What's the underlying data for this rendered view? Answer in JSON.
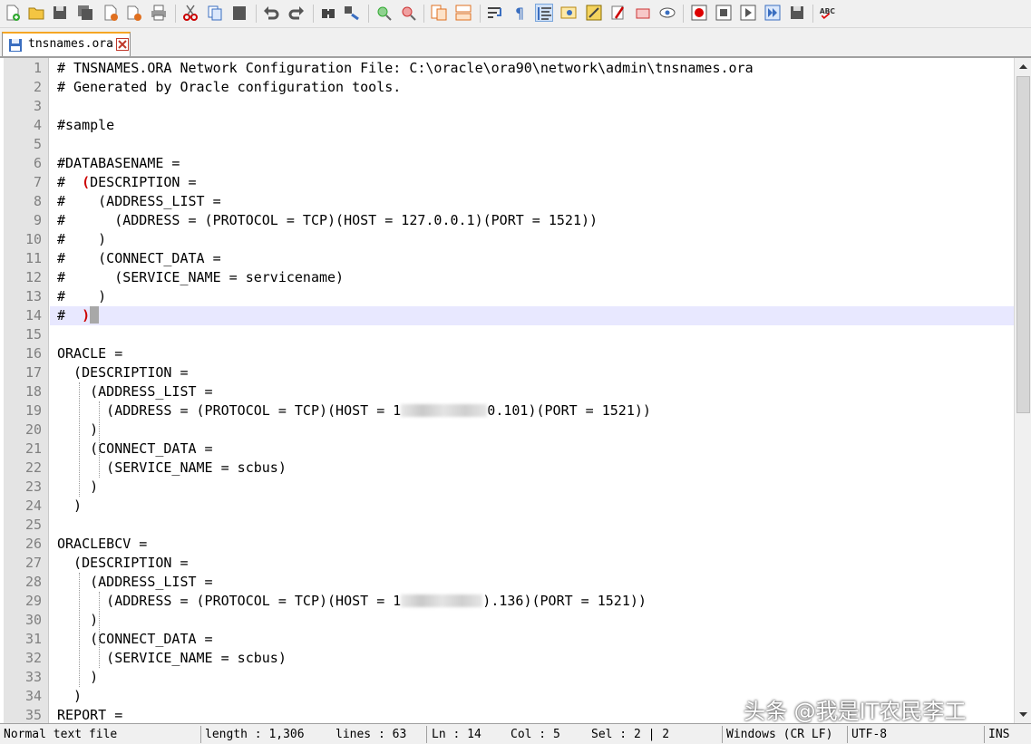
{
  "toolbar": {
    "icons": [
      "new-file-icon",
      "open-file-icon",
      "save-icon",
      "save-all-icon",
      "close-icon",
      "close-all-icon",
      "print-icon",
      "cut-icon",
      "copy-icon",
      "paste-icon",
      "undo-icon",
      "redo-icon",
      "find-icon",
      "replace-icon",
      "zoom-in-icon",
      "zoom-out-icon",
      "sync-vertical-icon",
      "sync-horizontal-icon",
      "word-wrap-icon",
      "show-all-chars-icon",
      "indent-guide-icon",
      "user-language-icon",
      "function-list-icon",
      "folder-workspace-icon",
      "document-map-icon",
      "monitor-icon",
      "record-macro-icon",
      "stop-macro-icon",
      "playback-macro-icon",
      "run-macro-multiple-icon",
      "save-macro-icon",
      "spell-check-icon"
    ],
    "spellcheck_label": "ABC"
  },
  "tab": {
    "label": "tnsnames.ora"
  },
  "editor": {
    "current_line": 14,
    "lines": [
      {
        "n": "1",
        "t": "# TNSNAMES.ORA Network Configuration File: C:\\oracle\\ora90\\network\\admin\\tnsnames.ora"
      },
      {
        "n": "2",
        "t": "# Generated by Oracle configuration tools."
      },
      {
        "n": "3",
        "t": ""
      },
      {
        "n": "4",
        "t": "#sample"
      },
      {
        "n": "5",
        "t": ""
      },
      {
        "n": "6",
        "t": "#DATABASENAME ="
      },
      {
        "n": "7",
        "t": "#  (DESCRIPTION ="
      },
      {
        "n": "8",
        "t": "#    (ADDRESS_LIST ="
      },
      {
        "n": "9",
        "t": "#      (ADDRESS = (PROTOCOL = TCP)(HOST = 127.0.0.1)(PORT = 1521))"
      },
      {
        "n": "10",
        "t": "#    )"
      },
      {
        "n": "11",
        "t": "#    (CONNECT_DATA ="
      },
      {
        "n": "12",
        "t": "#      (SERVICE_NAME = servicename)"
      },
      {
        "n": "13",
        "t": "#    )"
      },
      {
        "n": "14",
        "t": "#  )"
      },
      {
        "n": "15",
        "t": ""
      },
      {
        "n": "16",
        "t": "ORACLE ="
      },
      {
        "n": "17",
        "t": "  (DESCRIPTION ="
      },
      {
        "n": "18",
        "t": "    (ADDRESS_LIST ="
      },
      {
        "n": "19",
        "t": "      (ADDRESS = (PROTOCOL = TCP)(HOST = 1"
      },
      {
        "n": "20",
        "t": "    )"
      },
      {
        "n": "21",
        "t": "    (CONNECT_DATA ="
      },
      {
        "n": "22",
        "t": "      (SERVICE_NAME = scbus)"
      },
      {
        "n": "23",
        "t": "    )"
      },
      {
        "n": "24",
        "t": "  )"
      },
      {
        "n": "25",
        "t": ""
      },
      {
        "n": "26",
        "t": "ORACLEBCV ="
      },
      {
        "n": "27",
        "t": "  (DESCRIPTION ="
      },
      {
        "n": "28",
        "t": "    (ADDRESS_LIST ="
      },
      {
        "n": "29",
        "t": "      (ADDRESS = (PROTOCOL = TCP)(HOST = 1"
      },
      {
        "n": "30",
        "t": "    )"
      },
      {
        "n": "31",
        "t": "    (CONNECT_DATA ="
      },
      {
        "n": "32",
        "t": "      (SERVICE_NAME = scbus)"
      },
      {
        "n": "33",
        "t": "    )"
      },
      {
        "n": "34",
        "t": "  )"
      },
      {
        "n": "35",
        "t": "REPORT ="
      }
    ],
    "line19_tail": "0.101)(PORT = 1521))",
    "line29_tail": ").136)(PORT = 1521))"
  },
  "statusbar": {
    "file_type": "Normal text file",
    "length": "length : 1,306",
    "lines": "lines : 63",
    "ln": "Ln : 14",
    "col": "Col : 5",
    "sel": "Sel : 2 | 2",
    "eol": "Windows (CR LF)",
    "encoding": "UTF-8",
    "mode": "INS"
  },
  "watermark": "头条 @我是IT农民李工",
  "colors": {
    "brace_match": "#cc0000",
    "current_line": "#e8e8ff",
    "gutter": "#e4e4e4",
    "tab_accent": "#f5a623"
  }
}
